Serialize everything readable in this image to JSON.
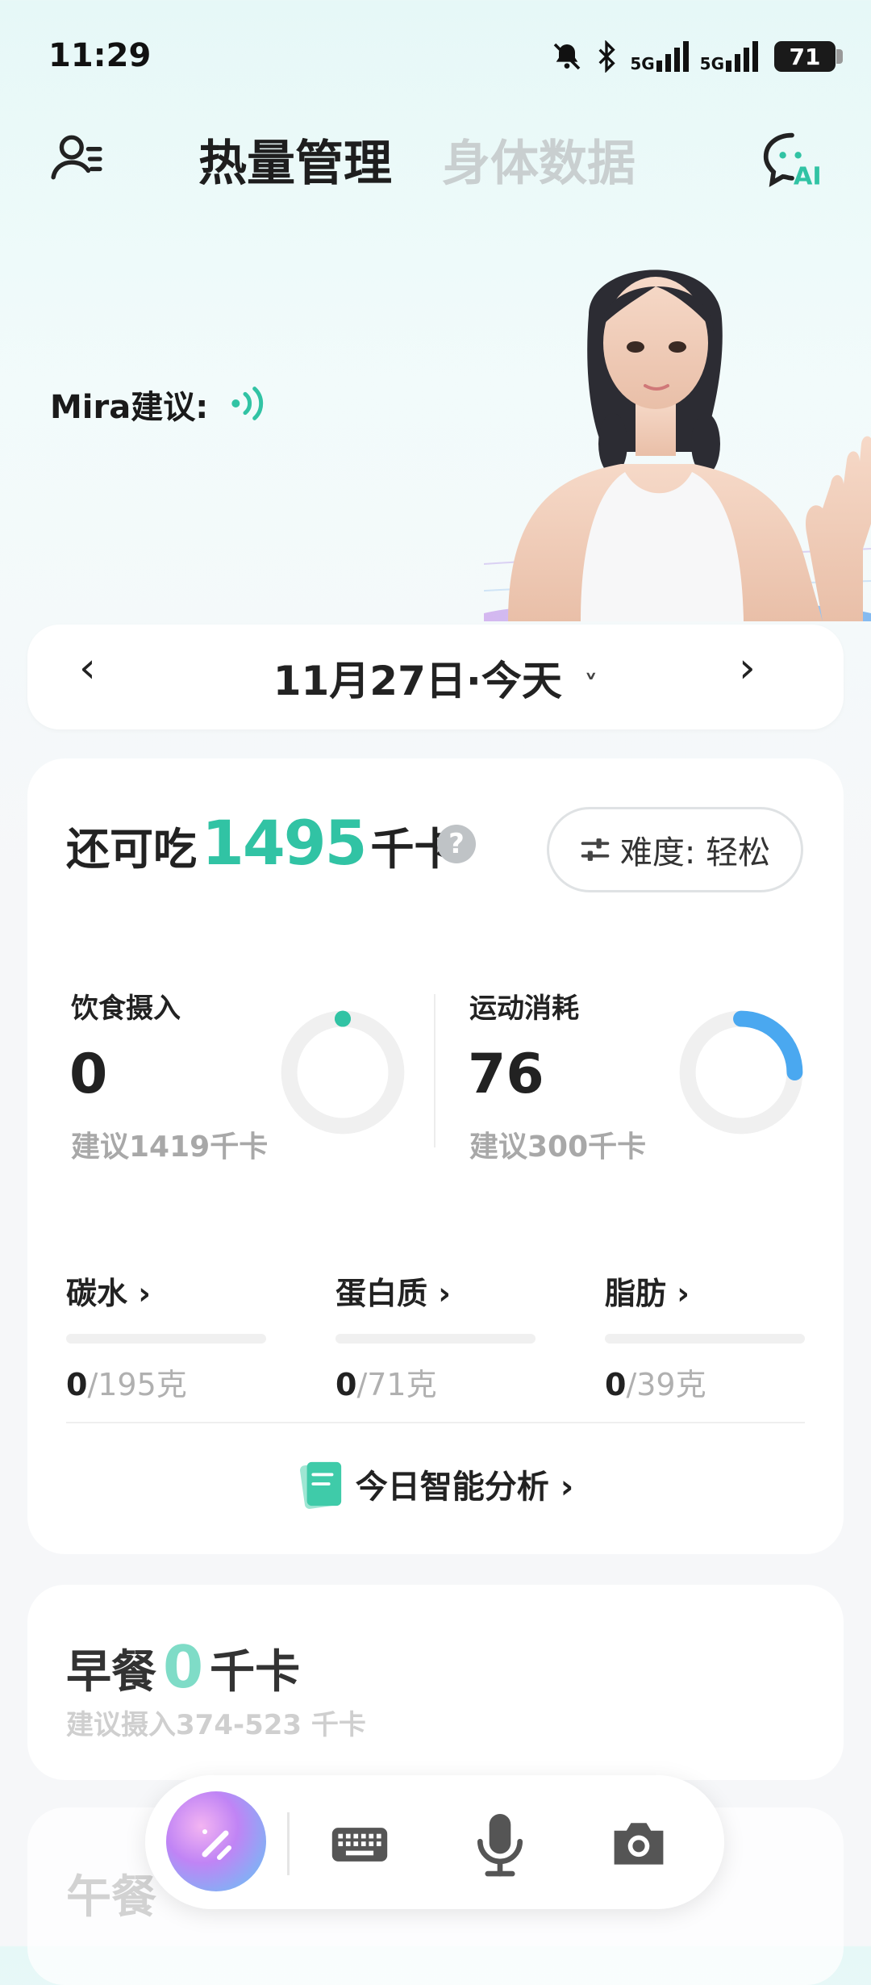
{
  "status_bar": {
    "time": "11:29",
    "battery": "71",
    "net1": "5G",
    "net2": "5G"
  },
  "header": {
    "tab_active": "热量管理",
    "tab_inactive": "身体数据"
  },
  "mira": {
    "label": "Mira建议:"
  },
  "date_bar": {
    "prev": "‹",
    "date": "11月27日·今天",
    "dropdown": "˅",
    "next": "›"
  },
  "summary": {
    "remain_label": "还可吃",
    "remain_value": "1495",
    "remain_unit": "千卡",
    "help": "?",
    "difficulty": "难度: 轻松"
  },
  "intake": {
    "title": "饮食摄入",
    "value": "0",
    "hint": "建议1419千卡",
    "progress": 0
  },
  "exercise": {
    "title": "运动消耗",
    "value": "76",
    "hint": "建议300千卡",
    "progress": 0.25
  },
  "macros": [
    {
      "label": "碳水 ›",
      "current": "0",
      "target": "/195克"
    },
    {
      "label": "蛋白质 ›",
      "current": "0",
      "target": "/71克"
    },
    {
      "label": "脂肪 ›",
      "current": "0",
      "target": "/39克"
    }
  ],
  "analysis": {
    "label": "今日智能分析 ›"
  },
  "breakfast": {
    "title": "早餐",
    "value": "0",
    "unit": "千卡",
    "hint": "建议摄入374-523 千卡"
  },
  "lunch": {
    "title": "午餐"
  },
  "colors": {
    "accent": "#31c3a4",
    "exercise": "#4aa8f0"
  },
  "icons": [
    "profile-icon",
    "ai-chat-icon",
    "voice-wave-icon",
    "help-icon",
    "sliders-icon",
    "notes-icon",
    "magic-wand-icon",
    "keyboard-icon",
    "mic-icon",
    "camera-icon"
  ]
}
